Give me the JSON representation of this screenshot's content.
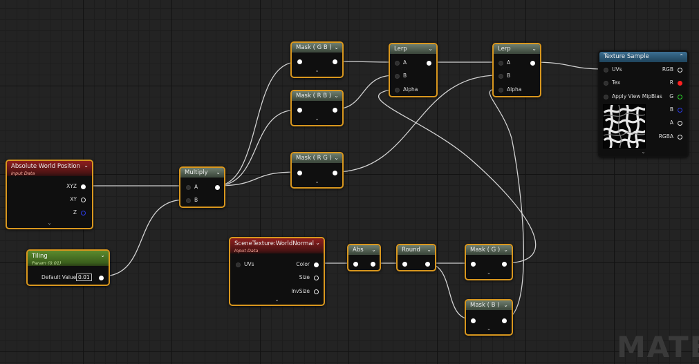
{
  "nodes": {
    "absolute_world_position": {
      "title": "Absolute World Position",
      "subtitle": "Input Data",
      "pins": {
        "xyz": "XYZ",
        "xy": "XY",
        "z": "Z"
      }
    },
    "tiling": {
      "title": "Tiling",
      "subtitle": "Param (0.01)",
      "default_label": "Default Value",
      "default_value": "0.01"
    },
    "multiply": {
      "title": "Multiply",
      "pins": {
        "a": "A",
        "b": "B"
      }
    },
    "mask_gb": {
      "title": "Mask ( G B )"
    },
    "mask_rb": {
      "title": "Mask ( R B )"
    },
    "mask_rg": {
      "title": "Mask ( R G )"
    },
    "lerp_1": {
      "title": "Lerp",
      "pins": {
        "a": "A",
        "b": "B",
        "alpha": "Alpha"
      }
    },
    "lerp_2": {
      "title": "Lerp",
      "pins": {
        "a": "A",
        "b": "B",
        "alpha": "Alpha"
      }
    },
    "texture_sample": {
      "title": "Texture Sample",
      "pins": {
        "uvs": "UVs",
        "tex": "Tex",
        "mipbias": "Apply View MipBias",
        "rgb": "RGB",
        "r": "R",
        "g": "G",
        "b": "B",
        "a": "A",
        "rgba": "RGBA"
      }
    },
    "scene_texture": {
      "title": "SceneTexture:WorldNormal",
      "subtitle": "Input Data",
      "pins": {
        "uvs": "UVs",
        "color": "Color",
        "size": "Size",
        "invsize": "InvSize"
      }
    },
    "abs": {
      "title": "Abs"
    },
    "round": {
      "title": "Round"
    },
    "mask_g": {
      "title": "Mask ( G )"
    },
    "mask_b": {
      "title": "Mask ( B )"
    }
  },
  "watermark": "MATE",
  "colors": {
    "selection_border": "#d9971e",
    "input_header": "#8e1e1e",
    "param_header": "#5b8a2e",
    "texture_header": "#3c6f93",
    "wire": "#e6e6e6"
  }
}
